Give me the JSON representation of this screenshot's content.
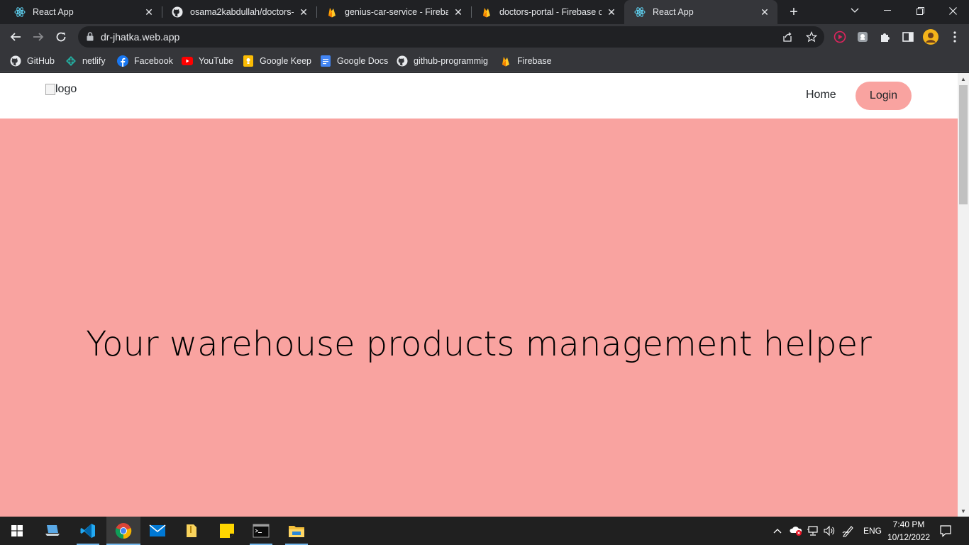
{
  "browser": {
    "tabs": [
      {
        "title": "React App",
        "icon": "react-icon",
        "active": false
      },
      {
        "title": "osama2kabdullah/doctors-po",
        "icon": "github-icon",
        "active": false
      },
      {
        "title": "genius-car-service - Firebase",
        "icon": "firebase-icon",
        "active": false
      },
      {
        "title": "doctors-portal - Firebase con",
        "icon": "firebase-icon",
        "active": false
      },
      {
        "title": "React App",
        "icon": "react-icon",
        "active": true
      }
    ],
    "url": "dr-jhatka.web.app",
    "bookmarks": [
      {
        "label": "GitHub",
        "icon": "github-icon"
      },
      {
        "label": "netlify",
        "icon": "netlify-icon"
      },
      {
        "label": "Facebook",
        "icon": "facebook-icon"
      },
      {
        "label": "YouTube",
        "icon": "youtube-icon"
      },
      {
        "label": "Google Keep",
        "icon": "google-keep-icon"
      },
      {
        "label": "Google Docs",
        "icon": "google-docs-icon"
      },
      {
        "label": "github-programmig",
        "icon": "github-icon"
      },
      {
        "label": "Firebase",
        "icon": "firebase-icon"
      }
    ]
  },
  "site": {
    "logo_alt": "logo",
    "nav": {
      "home": "Home",
      "login": "Login"
    },
    "hero_title": "Your warehouse products management helper"
  },
  "taskbar": {
    "language": "ENG",
    "time": "7:40 PM",
    "date": "10/12/2022"
  },
  "colors": {
    "hero_bg": "#f9a3a0",
    "login_bg": "#f9a3a0",
    "chrome_dark": "#202124",
    "chrome_toolbar": "#35363a"
  }
}
